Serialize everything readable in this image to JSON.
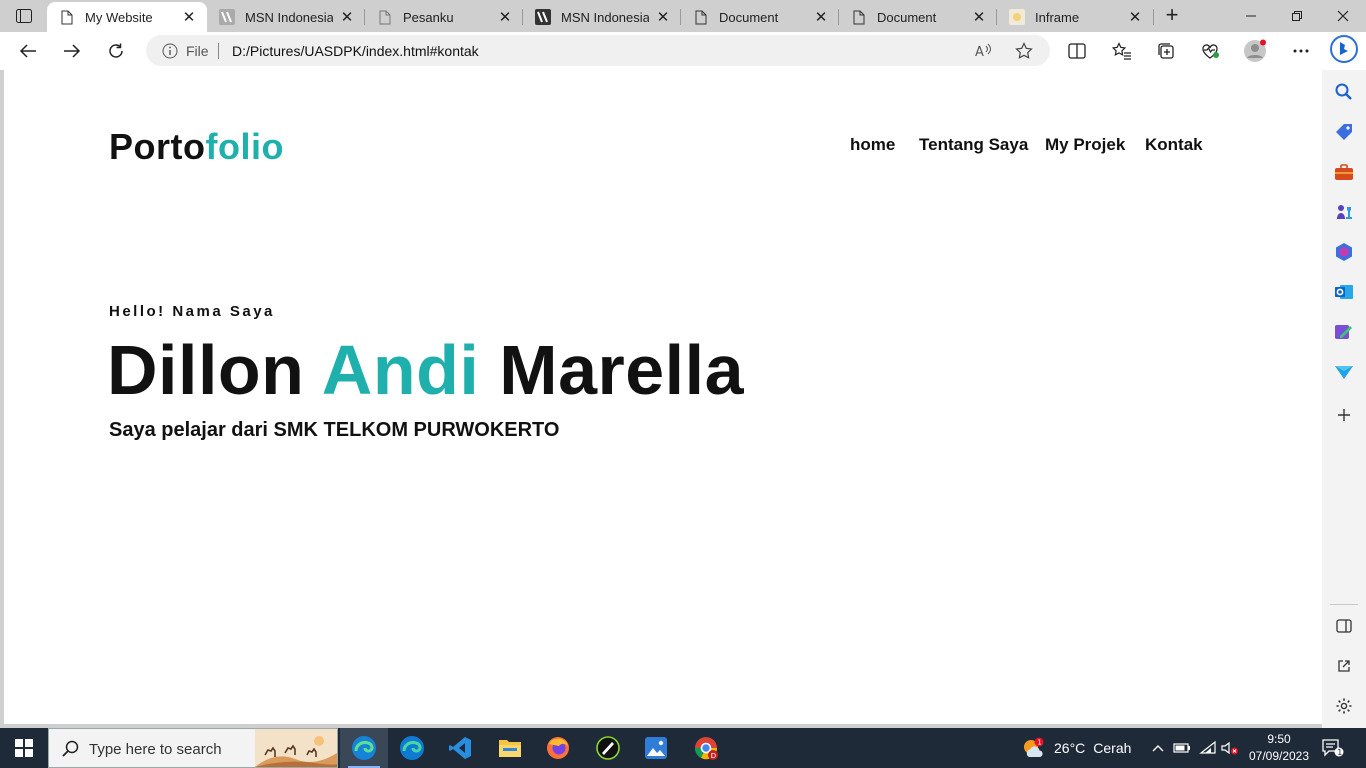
{
  "browser": {
    "tabs": [
      {
        "title": "My Website",
        "favicon": "page-icon",
        "active": true
      },
      {
        "title": "MSN Indonesia | M",
        "favicon": "msn-icon",
        "active": false
      },
      {
        "title": "Pesanku",
        "favicon": "page-icon",
        "active": false
      },
      {
        "title": "MSN Indonesia | M",
        "favicon": "msn-icon",
        "active": false
      },
      {
        "title": "Document",
        "favicon": "page-icon",
        "active": false
      },
      {
        "title": "Document",
        "favicon": "page-icon",
        "active": false
      },
      {
        "title": "Inframe",
        "favicon": "inframe-icon",
        "active": false
      }
    ],
    "address": {
      "scheme_label": "File",
      "url": "D:/Pictures/UASDPK/index.html#kontak"
    },
    "accent_color": "#1fb0ae"
  },
  "site": {
    "brand": {
      "part1": "Porto",
      "part2": "folio"
    },
    "nav": [
      "home",
      "Tentang Saya",
      "My Projek",
      "Kontak"
    ],
    "hero": {
      "greeting": "Hello! Nama Saya",
      "name_first": "Dillon",
      "name_middle": "Andi",
      "name_last": "Marella",
      "subtitle": "Saya pelajar dari SMK TELKOM PURWOKERTO"
    }
  },
  "taskbar": {
    "search_placeholder": "Type here to search",
    "weather": {
      "temp": "26°C",
      "condition": "Cerah",
      "badge": "1"
    },
    "clock": {
      "time": "9:50",
      "date": "07/09/2023"
    },
    "notification_count": "1"
  }
}
